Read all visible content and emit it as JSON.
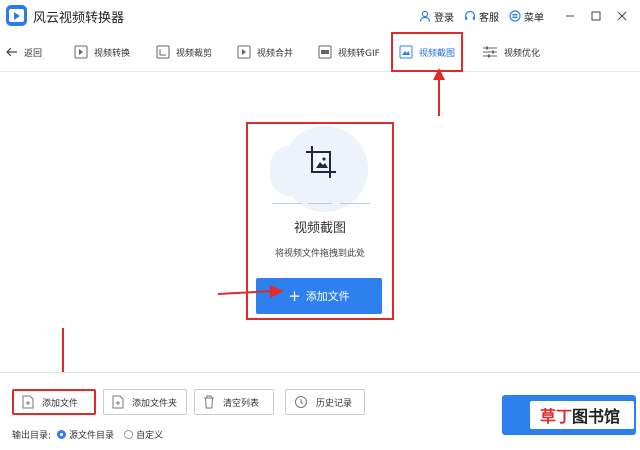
{
  "app": {
    "title": "风云视频转换器"
  },
  "header": {
    "login": "登录",
    "service": "客服",
    "menu": "菜单"
  },
  "toolbar": {
    "back": "返回",
    "tools": [
      "视频转换",
      "视频裁剪",
      "视频合并",
      "视频转GIF",
      "视频截图",
      "视频优化"
    ],
    "active_index": 4
  },
  "panel": {
    "title": "视频截图",
    "hint": "将视频文件拖拽到此处",
    "add_file": "添加文件"
  },
  "bottom": {
    "buttons": [
      "添加文件",
      "添加文件夹",
      "清空列表",
      "历史记录"
    ],
    "output_label": "输出目录:",
    "options": [
      "源文件目录",
      "自定义"
    ],
    "selected_option": 0
  },
  "watermark": {
    "part1": "草",
    "part2": "丁",
    "part3": "图书馆"
  },
  "colors": {
    "accent": "#2e80ef",
    "highlight": "#e02b2b"
  }
}
